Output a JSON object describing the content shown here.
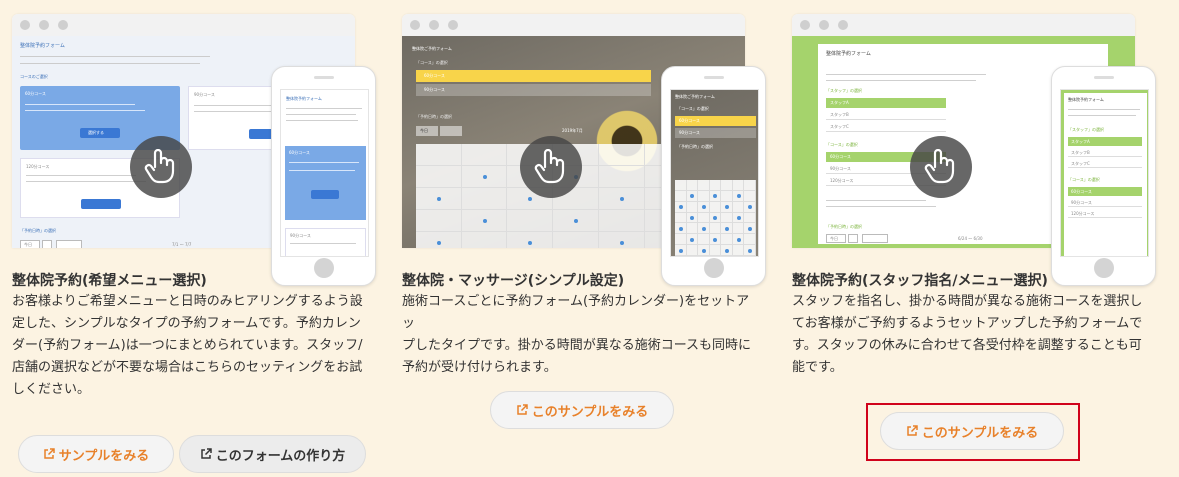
{
  "cards": [
    {
      "title": "整体院予約(希望メニュー選択)",
      "desc_lines": [
        "お客様よりご希望メニューと日時のみヒアリングするよう設",
        "定した、シンプルなタイプの予約フォームです。予約カレン",
        "ダー(予約フォーム)は一つにまとめられています。スタッフ/",
        "店舗の選択などが不要な場合はこちらのセッティングをお試",
        "しください。"
      ],
      "buttons": [
        {
          "label": "サンプルをみる",
          "icon": "external-link-icon"
        },
        {
          "label": "このフォームの作り方",
          "icon": "external-link-icon"
        }
      ],
      "mock": {
        "form_title": "整体院予約フォーム",
        "course_title": "コースのご選択",
        "course_a": "60分コース",
        "course_b": "90分コース",
        "course_c": "120分コース",
        "select_label": "選択する",
        "cal_title": "「予約日時」の選択",
        "today": "今日",
        "date_range": "7/1 〜 7/7"
      }
    },
    {
      "title": "整体院・マッサージ(シンプル設定)",
      "desc_lines": [
        "施術コースごとに予約フォーム(予約カレンダー)をセットアッ",
        "プしたタイプです。掛かる時間が異なる施術コースも同時に",
        "予約が受け付けられます。"
      ],
      "buttons": [
        {
          "label": "このサンプルをみる",
          "icon": "external-link-icon"
        }
      ],
      "mock": {
        "form_title": "整体院ご予約フォーム",
        "course_title": "「コース」の選択",
        "course_a": "60分コース",
        "course_b": "90分コース",
        "cal_title": "「予約日時」の選択",
        "today": "今日",
        "month": "2019年7月"
      }
    },
    {
      "title": "整体院予約(スタッフ指名/メニュー選択)",
      "desc_lines": [
        "スタッフを指名し、掛かる時間が異なる施術コースを選択し",
        "てお客様がご予約するようセットアップした予約フォームで",
        "す。スタッフの休みに合わせて各受付枠を調整することも可",
        "能です。"
      ],
      "buttons": [
        {
          "label": "このサンプルをみる",
          "icon": "external-link-icon"
        }
      ],
      "mock": {
        "form_title": "整体院予約フォーム",
        "staff_title": "「スタッフ」の選択",
        "staff_a": "スタッフA",
        "staff_b": "スタッフB",
        "staff_c": "スタッフC",
        "course_title": "「コース」の選択",
        "course_a": "60分コース",
        "course_b": "90分コース",
        "course_c": "120分コース",
        "cal_title": "「予約日時」の選択",
        "today": "今日",
        "date_range": "6/24 〜 6/30"
      }
    }
  ],
  "colors": {
    "background": "#fcf3e2",
    "accent_orange": "#e8812a",
    "highlight_red": "#d0021b",
    "card1_blue": "#7aa9e6",
    "card2_yellow": "#f8d44a",
    "card3_green": "#a5d36c"
  }
}
